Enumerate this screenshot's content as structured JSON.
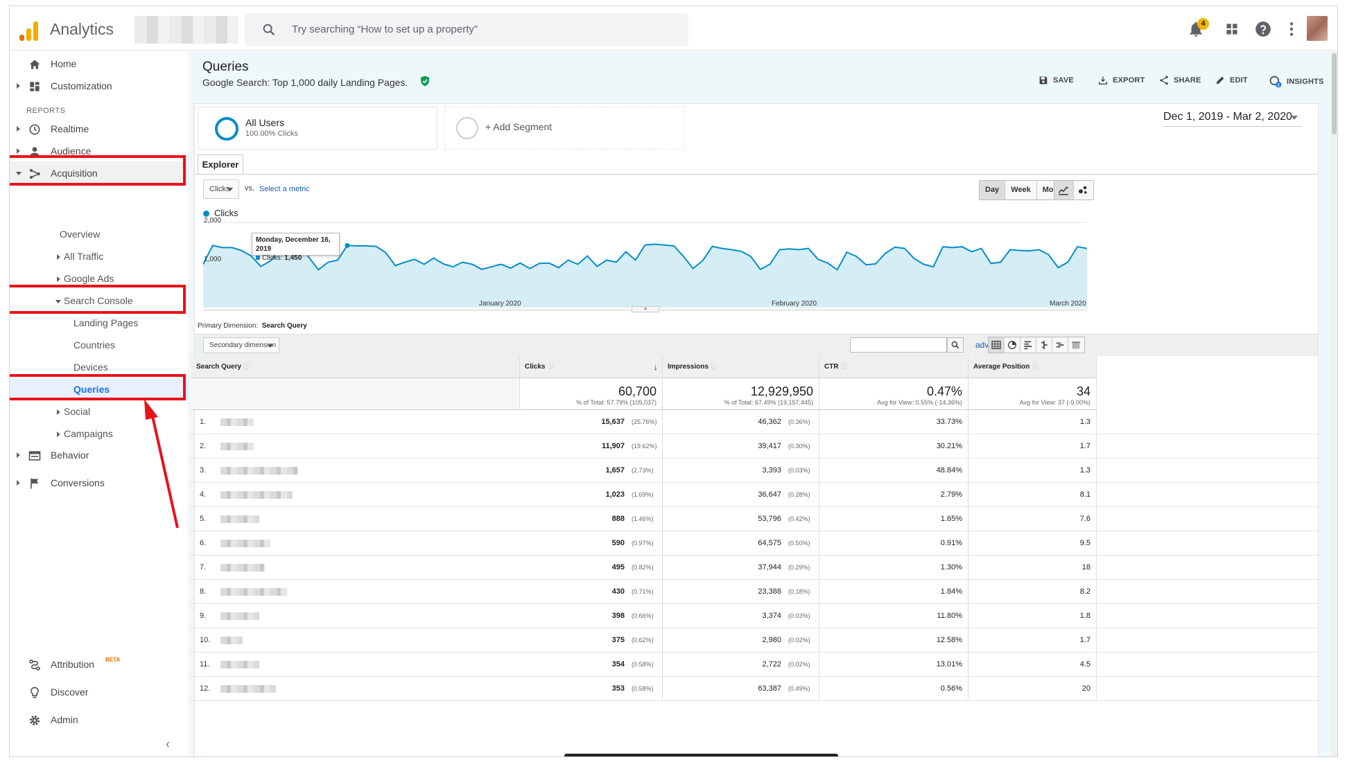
{
  "app": {
    "title": "Analytics"
  },
  "topbar": {
    "search_placeholder": "Try searching “How to set up a property”",
    "notification_count": "4"
  },
  "sidebar": {
    "home": "Home",
    "customization": "Customization",
    "reports_header": "REPORTS",
    "realtime": "Realtime",
    "audience": "Audience",
    "acquisition": "Acquisition",
    "acq_sub": {
      "overview": "Overview",
      "all_traffic": "All Traffic",
      "google_ads": "Google Ads",
      "search_console": "Search Console",
      "landing_pages": "Landing Pages",
      "countries": "Countries",
      "devices": "Devices",
      "queries": "Queries",
      "social": "Social",
      "campaigns": "Campaigns"
    },
    "behavior": "Behavior",
    "conversions": "Conversions",
    "attribution": "Attribution",
    "attribution_badge": "BETA",
    "discover": "Discover",
    "admin": "Admin"
  },
  "report": {
    "title": "Queries",
    "subtitle": "Google Search: Top 1,000 daily Landing Pages.",
    "actions": {
      "save": "SAVE",
      "export": "EXPORT",
      "share": "SHARE",
      "edit": "EDIT",
      "insights": "INSIGHTS"
    },
    "segment1": {
      "title": "All Users",
      "subtitle": "100.00% Clicks"
    },
    "segment2": {
      "label": "+ Add Segment"
    },
    "date_range": "Dec 1, 2019 - Mar 2, 2020",
    "tab": "Explorer",
    "metric_dropdown": "Clicks",
    "vs": "vs.",
    "select_metric": "Select a metric",
    "granularity": {
      "day": "Day",
      "week": "Week",
      "month": "Month"
    },
    "primary_dimension_label": "Primary Dimension:",
    "primary_dimension_value": "Search Query",
    "secondary_dimension": "Secondary dimension",
    "advanced": "advanced"
  },
  "chart_data": {
    "type": "area",
    "series": [
      {
        "name": "Clicks",
        "values": [
          1000,
          1450,
          1400,
          1400,
          1330,
          1200,
          950,
          1080,
          1350,
          1450,
          1480,
          1170,
          870,
          1050,
          1100,
          1450,
          1440,
          1440,
          1430,
          1280,
          970,
          1050,
          1120,
          1000,
          1150,
          1010,
          940,
          1050,
          1000,
          880,
          940,
          1000,
          910,
          1030,
          900,
          1020,
          1030,
          920,
          1100,
          1000,
          1200,
          950,
          1100,
          1050,
          1300,
          1100,
          1460,
          1480,
          1460,
          1440,
          1190,
          900,
          1090,
          1430,
          1380,
          1350,
          1310,
          1190,
          880,
          1000,
          1350,
          1370,
          1350,
          1380,
          1120,
          1030,
          870,
          1290,
          1190,
          990,
          1010,
          1260,
          1410,
          1380,
          1140,
          1000,
          940,
          1420,
          1400,
          1420,
          1300,
          1380,
          1020,
          1050,
          1350,
          1330,
          1320,
          1350,
          1230,
          920,
          1050,
          1420,
          1380
        ]
      }
    ],
    "x_labels": [
      "January 2020",
      "February 2020",
      "March 2020"
    ],
    "y_ticks": [
      "2,000",
      "1,000"
    ],
    "ylim": [
      0,
      2000
    ],
    "tooltip": {
      "date": "Monday, December 16, 2019",
      "label": "Clicks:",
      "value": "1,450"
    }
  },
  "table": {
    "headers": [
      "Search Query",
      "Clicks",
      "Impressions",
      "CTR",
      "Average Position"
    ],
    "totals": {
      "clicks": "60,700",
      "clicks_sub": "% of Total: 57.79% (105,037)",
      "impressions": "12,929,950",
      "impressions_sub": "% of Total: 67.49% (19,157,445)",
      "ctr": "0.47%",
      "ctr_sub": "Avg for View: 0.55% (-14.36%)",
      "position": "34",
      "position_sub": "Avg for View: 37 (-9.00%)"
    },
    "rows": [
      {
        "n": "1.",
        "clicks": "15,637",
        "clicks_pct": "(25.76%)",
        "impr": "46,362",
        "impr_pct": "(0.36%)",
        "ctr": "33.73%",
        "pos": "1.3"
      },
      {
        "n": "2.",
        "clicks": "11,907",
        "clicks_pct": "(19.62%)",
        "impr": "39,417",
        "impr_pct": "(0.30%)",
        "ctr": "30.21%",
        "pos": "1.7"
      },
      {
        "n": "3.",
        "clicks": "1,657",
        "clicks_pct": "(2.73%)",
        "impr": "3,393",
        "impr_pct": "(0.03%)",
        "ctr": "48.84%",
        "pos": "1.3"
      },
      {
        "n": "4.",
        "clicks": "1,023",
        "clicks_pct": "(1.69%)",
        "impr": "36,647",
        "impr_pct": "(0.28%)",
        "ctr": "2.79%",
        "pos": "8.1"
      },
      {
        "n": "5.",
        "clicks": "888",
        "clicks_pct": "(1.46%)",
        "impr": "53,796",
        "impr_pct": "(0.42%)",
        "ctr": "1.65%",
        "pos": "7.6"
      },
      {
        "n": "6.",
        "clicks": "590",
        "clicks_pct": "(0.97%)",
        "impr": "64,575",
        "impr_pct": "(0.50%)",
        "ctr": "0.91%",
        "pos": "9.5"
      },
      {
        "n": "7.",
        "clicks": "495",
        "clicks_pct": "(0.82%)",
        "impr": "37,944",
        "impr_pct": "(0.29%)",
        "ctr": "1.30%",
        "pos": "18"
      },
      {
        "n": "8.",
        "clicks": "430",
        "clicks_pct": "(0.71%)",
        "impr": "23,388",
        "impr_pct": "(0.18%)",
        "ctr": "1.84%",
        "pos": "8.2"
      },
      {
        "n": "9.",
        "clicks": "398",
        "clicks_pct": "(0.66%)",
        "impr": "3,374",
        "impr_pct": "(0.03%)",
        "ctr": "11.80%",
        "pos": "1.8"
      },
      {
        "n": "10.",
        "clicks": "375",
        "clicks_pct": "(0.62%)",
        "impr": "2,980",
        "impr_pct": "(0.02%)",
        "ctr": "12.58%",
        "pos": "1.7"
      },
      {
        "n": "11.",
        "clicks": "354",
        "clicks_pct": "(0.58%)",
        "impr": "2,722",
        "impr_pct": "(0.02%)",
        "ctr": "13.01%",
        "pos": "4.5"
      },
      {
        "n": "12.",
        "clicks": "353",
        "clicks_pct": "(0.58%)",
        "impr": "63,387",
        "impr_pct": "(0.49%)",
        "ctr": "0.56%",
        "pos": "20"
      }
    ]
  },
  "colors": {
    "accent": "#058dc7",
    "highlight": "#e8121b",
    "selected_nav": "#1a73e8",
    "chart_fill": "#d5edf5"
  }
}
